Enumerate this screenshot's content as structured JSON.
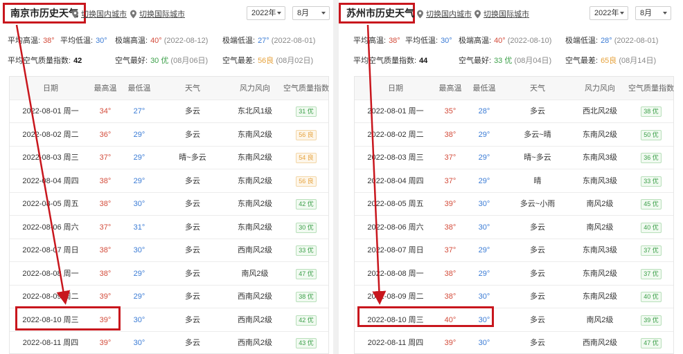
{
  "columns": [
    "日期",
    "最高温",
    "最低温",
    "天气",
    "风力风向",
    "空气质量指数"
  ],
  "switch_domestic": "切换国内城市",
  "switch_intl": "切换国际城市",
  "labels": {
    "avg_high": "平均高温:",
    "avg_low": "平均低温:",
    "ext_high": "极端高温:",
    "ext_low": "极端低温:",
    "avg_aqi": "平均空气质量指数:",
    "aqi_best": "空气最好:",
    "aqi_worst": "空气最差:"
  },
  "colors": {
    "highlight": "#c8161d",
    "high_temp": "#d34b3a",
    "low_temp": "#3a7bd5",
    "good": "#3da04a",
    "fair": "#e6a23c"
  },
  "left": {
    "title": "南京市历史天气",
    "year": "2022年",
    "month": "8月",
    "avg_high": "38°",
    "avg_low": "30°",
    "ext_high": "40°",
    "ext_high_date": "(2022-08-12)",
    "ext_low": "27°",
    "ext_low_date": "(2022-08-01)",
    "avg_aqi": "42",
    "aqi_best": "30 优",
    "aqi_best_date": "(08月06日)",
    "aqi_worst": "56良",
    "aqi_worst_date": "(08月02日)",
    "rows": [
      {
        "date": "2022-08-01 周一",
        "hi": "34°",
        "lo": "27°",
        "wx": "多云",
        "wind": "东北风1级",
        "aqi": "31 优",
        "q": "good"
      },
      {
        "date": "2022-08-02 周二",
        "hi": "36°",
        "lo": "29°",
        "wx": "多云",
        "wind": "东南风2级",
        "aqi": "56 良",
        "q": "fair"
      },
      {
        "date": "2022-08-03 周三",
        "hi": "37°",
        "lo": "29°",
        "wx": "晴~多云",
        "wind": "东南风2级",
        "aqi": "54 良",
        "q": "fair"
      },
      {
        "date": "2022-08-04 周四",
        "hi": "38°",
        "lo": "29°",
        "wx": "多云",
        "wind": "东南风2级",
        "aqi": "56 良",
        "q": "fair"
      },
      {
        "date": "2022-08-05 周五",
        "hi": "38°",
        "lo": "30°",
        "wx": "多云",
        "wind": "东南风2级",
        "aqi": "42 优",
        "q": "good"
      },
      {
        "date": "2022-08-06 周六",
        "hi": "37°",
        "lo": "31°",
        "wx": "多云",
        "wind": "东南风2级",
        "aqi": "30 优",
        "q": "good"
      },
      {
        "date": "2022-08-07 周日",
        "hi": "38°",
        "lo": "30°",
        "wx": "多云",
        "wind": "西南风2级",
        "aqi": "33 优",
        "q": "good"
      },
      {
        "date": "2022-08-08 周一",
        "hi": "38°",
        "lo": "29°",
        "wx": "多云",
        "wind": "南风2级",
        "aqi": "47 优",
        "q": "good"
      },
      {
        "date": "2022-08-09 周二",
        "hi": "39°",
        "lo": "29°",
        "wx": "多云",
        "wind": "西南风2级",
        "aqi": "38 优",
        "q": "good"
      },
      {
        "date": "2022-08-10 周三",
        "hi": "39°",
        "lo": "30°",
        "wx": "多云",
        "wind": "西南风2级",
        "aqi": "42 优",
        "q": "good"
      },
      {
        "date": "2022-08-11 周四",
        "hi": "39°",
        "lo": "30°",
        "wx": "多云",
        "wind": "西南风2级",
        "aqi": "43 优",
        "q": "good"
      }
    ]
  },
  "right": {
    "title": "苏州市历史天气",
    "year": "2022年",
    "month": "8月",
    "avg_high": "38°",
    "avg_low": "30°",
    "ext_high": "40°",
    "ext_high_date": "(2022-08-10)",
    "ext_low": "28°",
    "ext_low_date": "(2022-08-01)",
    "avg_aqi": "44",
    "aqi_best": "33 优",
    "aqi_best_date": "(08月04日)",
    "aqi_worst": "65良",
    "aqi_worst_date": "(08月14日)",
    "rows": [
      {
        "date": "2022-08-01 周一",
        "hi": "35°",
        "lo": "28°",
        "wx": "多云",
        "wind": "西北风2级",
        "aqi": "38 优",
        "q": "good"
      },
      {
        "date": "2022-08-02 周二",
        "hi": "38°",
        "lo": "29°",
        "wx": "多云~晴",
        "wind": "东南风2级",
        "aqi": "50 优",
        "q": "good"
      },
      {
        "date": "2022-08-03 周三",
        "hi": "37°",
        "lo": "29°",
        "wx": "晴~多云",
        "wind": "东南风3级",
        "aqi": "36 优",
        "q": "good"
      },
      {
        "date": "2022-08-04 周四",
        "hi": "37°",
        "lo": "29°",
        "wx": "晴",
        "wind": "东南风3级",
        "aqi": "33 优",
        "q": "good"
      },
      {
        "date": "2022-08-05 周五",
        "hi": "39°",
        "lo": "30°",
        "wx": "多云~小雨",
        "wind": "南风2级",
        "aqi": "45 优",
        "q": "good"
      },
      {
        "date": "2022-08-06 周六",
        "hi": "38°",
        "lo": "30°",
        "wx": "多云",
        "wind": "南风2级",
        "aqi": "40 优",
        "q": "good"
      },
      {
        "date": "2022-08-07 周日",
        "hi": "37°",
        "lo": "29°",
        "wx": "多云",
        "wind": "东南风3级",
        "aqi": "37 优",
        "q": "good"
      },
      {
        "date": "2022-08-08 周一",
        "hi": "38°",
        "lo": "29°",
        "wx": "多云",
        "wind": "东南风2级",
        "aqi": "37 优",
        "q": "good"
      },
      {
        "date": "2022-08-09 周二",
        "hi": "38°",
        "lo": "30°",
        "wx": "多云",
        "wind": "东南风2级",
        "aqi": "40 优",
        "q": "good"
      },
      {
        "date": "2022-08-10 周三",
        "hi": "40°",
        "lo": "30°",
        "wx": "多云",
        "wind": "南风2级",
        "aqi": "39 优",
        "q": "good"
      },
      {
        "date": "2022-08-11 周四",
        "hi": "39°",
        "lo": "30°",
        "wx": "多云",
        "wind": "西南风2级",
        "aqi": "47 优",
        "q": "good"
      }
    ]
  }
}
